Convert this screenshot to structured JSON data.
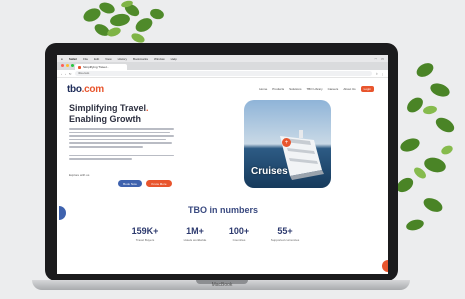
{
  "browser": {
    "menu_app": "Safari",
    "menu_items": [
      "File",
      "Edit",
      "View",
      "History",
      "Bookmarks",
      "Window",
      "Help"
    ],
    "tab_title": "Simplifying Travel...",
    "url": "tbo.com"
  },
  "site": {
    "logo_main": "tbo",
    "logo_tail": ".com",
    "nav": [
      "Home",
      "Products",
      "Solutions",
      "TBO Library",
      "Careers",
      "About Us"
    ],
    "login_label": "Login"
  },
  "hero": {
    "title_line1": "Simplifying Travel",
    "title_dot": ".",
    "title_line2": "Enabling Growth",
    "caption": "Explore with us",
    "button_primary": "Book Now",
    "button_secondary": "Know More"
  },
  "card": {
    "label": "Cruises",
    "play_icon": "plus-icon"
  },
  "numbers": {
    "title": "TBO in numbers",
    "stats": [
      {
        "value": "159K+",
        "label": "Travel Buyers"
      },
      {
        "value": "1M+",
        "label": "Hotels worldwide"
      },
      {
        "value": "100+",
        "label": "Countries"
      },
      {
        "value": "55+",
        "label": "Supported currencies"
      }
    ]
  },
  "device": {
    "brand": "MacBook"
  },
  "colors": {
    "accent": "#e8552d",
    "brand_navy": "#1f2d5a",
    "brand_blue": "#3e62ae"
  }
}
